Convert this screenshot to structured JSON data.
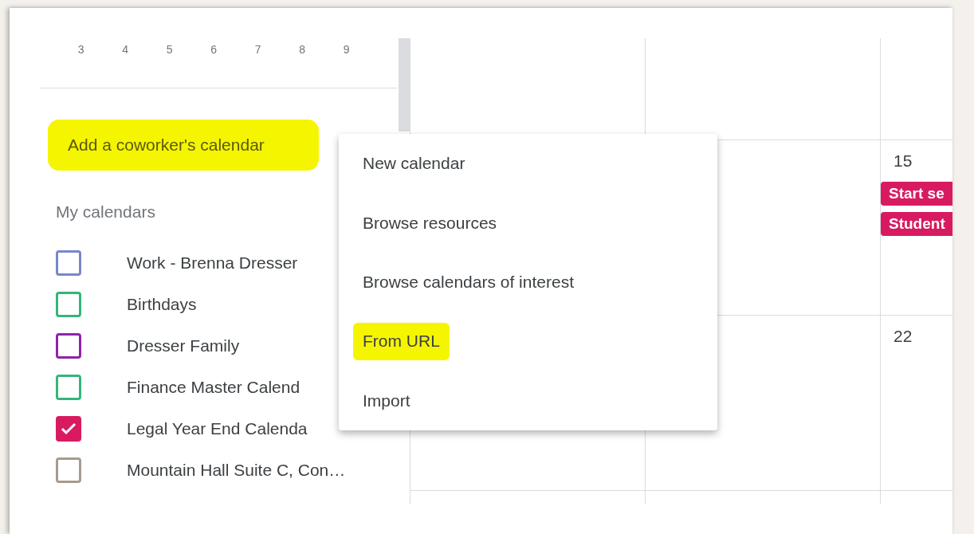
{
  "mini_calendar": {
    "days": [
      "3",
      "4",
      "5",
      "6",
      "7",
      "8",
      "9"
    ]
  },
  "coworker_search": {
    "placeholder": "Add a coworker's calendar",
    "highlighted": true
  },
  "my_calendars": {
    "title": "My calendars",
    "items": [
      {
        "label": "Work - Brenna Dresser",
        "checked": false,
        "color": "#7986cb"
      },
      {
        "label": "Birthdays",
        "checked": false,
        "color": "#33b679"
      },
      {
        "label": "Dresser Family",
        "checked": false,
        "color": "#8e24aa"
      },
      {
        "label": "Finance Master Calend",
        "checked": false,
        "color": "#33b679"
      },
      {
        "label": "Legal Year End Calenda",
        "checked": true,
        "color": "#d81b60"
      },
      {
        "label": "Mountain Hall Suite C, Con…",
        "checked": false,
        "color": "#a79b8e"
      }
    ]
  },
  "calendar_grid": {
    "days": [
      {
        "date": "15",
        "events": [
          {
            "title": "Start se",
            "color": "#d81b60"
          },
          {
            "title": "Student",
            "color": "#d81b60"
          }
        ]
      },
      {
        "date": "22"
      }
    ]
  },
  "add_menu": {
    "items": [
      {
        "label": "New calendar",
        "highlighted": false
      },
      {
        "label": "Browse resources",
        "highlighted": false
      },
      {
        "label": "Browse calendars of interest",
        "highlighted": false
      },
      {
        "label": "From URL",
        "highlighted": true
      },
      {
        "label": "Import",
        "highlighted": false
      }
    ]
  }
}
